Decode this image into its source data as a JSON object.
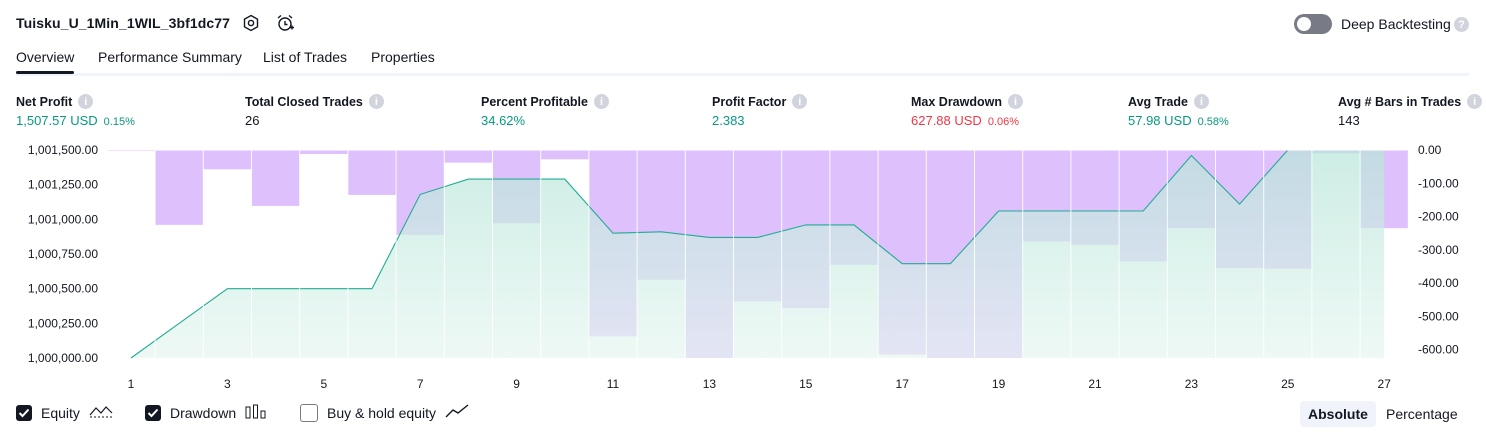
{
  "strategy": {
    "title": "Tuisku_U_1Min_1WIL_3bf1dc77"
  },
  "header": {
    "icons": [
      "settings-icon",
      "alarm-add-icon"
    ],
    "deep_backtesting": {
      "label": "Deep Backtesting",
      "enabled": false,
      "help": "?"
    }
  },
  "tabs": [
    {
      "label": "Overview",
      "active": true
    },
    {
      "label": "Performance Summary",
      "active": false
    },
    {
      "label": "List of Trades",
      "active": false
    },
    {
      "label": "Properties",
      "active": false
    }
  ],
  "metrics": [
    {
      "label": "Net Profit",
      "value": "1,507.57 USD",
      "pct": "0.15%",
      "color": "#089981"
    },
    {
      "label": "Total Closed Trades",
      "value": "26",
      "pct": "",
      "color": "#131722"
    },
    {
      "label": "Percent Profitable",
      "value": "34.62%",
      "pct": "",
      "color": "#089981"
    },
    {
      "label": "Profit Factor",
      "value": "2.383",
      "pct": "",
      "color": "#089981"
    },
    {
      "label": "Max Drawdown",
      "value": "627.88 USD",
      "pct": "0.06%",
      "color": "#f23645"
    },
    {
      "label": "Avg Trade",
      "value": "57.98 USD",
      "pct": "0.58%",
      "color": "#089981"
    },
    {
      "label": "Avg # Bars in Trades",
      "value": "143",
      "pct": "",
      "color": "#131722"
    }
  ],
  "chart_data": {
    "type": "area",
    "series": [
      {
        "name": "Equity",
        "x": [
          1,
          2,
          3,
          4,
          5,
          6,
          7,
          8,
          9,
          10,
          11,
          12,
          13,
          14,
          15,
          16,
          17,
          18,
          19,
          20,
          21,
          22,
          23,
          24,
          25,
          26,
          27
        ],
        "values": [
          1000000,
          1000250,
          1000500,
          1000500,
          1000500,
          1000500,
          1001180,
          1001290,
          1001290,
          1001290,
          1000900,
          1000910,
          1000870,
          1000870,
          1000960,
          1000960,
          1000680,
          1000680,
          1001060,
          1001060,
          1001060,
          1001060,
          1001460,
          1001110,
          1001500,
          1001500,
          1001500
        ]
      },
      {
        "name": "Drawdown",
        "x": [
          1,
          2,
          3,
          4,
          5,
          6,
          7,
          8,
          9,
          10,
          11,
          12,
          13,
          14,
          15,
          16,
          17,
          18,
          19,
          20,
          21,
          22,
          23,
          24,
          25,
          26,
          27
        ],
        "values": [
          0,
          -225,
          -58,
          -168,
          -12,
          -135,
          -255,
          -38,
          -220,
          -28,
          -560,
          -390,
          -625,
          -455,
          -475,
          -345,
          -615,
          -625,
          -625,
          -275,
          -285,
          -335,
          -235,
          -355,
          -357,
          -10,
          -235
        ]
      }
    ],
    "left_axis": {
      "ylim": [
        1000000,
        1001500
      ],
      "ticks": [
        "1,001,500.00",
        "1,001,250.00",
        "1,001,000.00",
        "1,000,750.00",
        "1,000,500.00",
        "1,000,250.00",
        "1,000,000.00"
      ]
    },
    "right_axis": {
      "ylim": [
        -625,
        0
      ],
      "ticks": [
        "0.00",
        "-100.00",
        "-200.00",
        "-300.00",
        "-400.00",
        "-500.00",
        "-600.00"
      ]
    },
    "x_ticks": [
      "1",
      "3",
      "5",
      "7",
      "9",
      "11",
      "13",
      "15",
      "17",
      "19",
      "21",
      "23",
      "25",
      "27"
    ],
    "colors": {
      "equity_line": "#22ab94",
      "equity_fill": "#d6f2ea",
      "drawdown_fill": "#d1a8fb"
    }
  },
  "legend": {
    "items": [
      {
        "label": "Equity",
        "checked": true,
        "icon": "equity-line-icon"
      },
      {
        "label": "Drawdown",
        "checked": true,
        "icon": "drawdown-bars-icon"
      },
      {
        "label": "Buy & hold equity",
        "checked": false,
        "icon": "buyhold-line-icon"
      }
    ],
    "modes": [
      {
        "label": "Absolute",
        "active": true
      },
      {
        "label": "Percentage",
        "active": false
      }
    ]
  }
}
